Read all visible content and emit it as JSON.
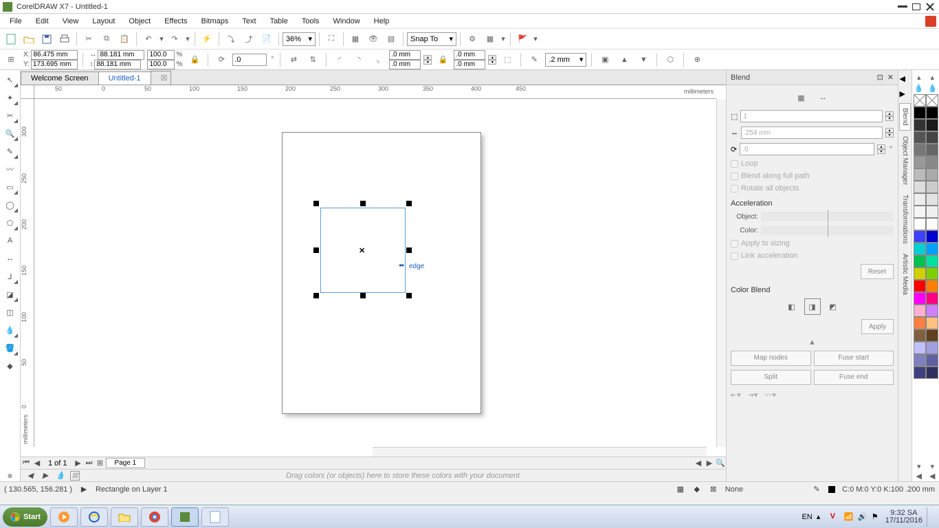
{
  "title": "CorelDRAW X7 - Untitled-1",
  "menu": [
    "File",
    "Edit",
    "View",
    "Layout",
    "Object",
    "Effects",
    "Bitmaps",
    "Text",
    "Table",
    "Tools",
    "Window",
    "Help"
  ],
  "toolbar1": {
    "zoom": "36%",
    "snapto": "Snap To"
  },
  "propbar": {
    "x": "86.475 mm",
    "y": "173.695 mm",
    "w": "88.181 mm",
    "h": "88.181 mm",
    "sx": "100.0",
    "sy": "100.0",
    "pct": "%",
    "rot": ".0",
    "corner1": ".0 mm",
    "corner2": ".0 mm",
    "corner3": ".0 mm",
    "corner4": ".0 mm",
    "outline": ".2 mm"
  },
  "doctabs": {
    "welcome": "Welcome Screen",
    "doc": "Untitled-1"
  },
  "ruler": {
    "units": "millimeters",
    "h": [
      "50",
      "0",
      "50",
      "100",
      "150",
      "200",
      "250",
      "300",
      "350",
      "400",
      "450"
    ],
    "v": [
      "300",
      "250",
      "200",
      "150",
      "100",
      "50",
      "0"
    ]
  },
  "canvas": {
    "edge": "edge"
  },
  "pagenav": {
    "of": "1 of 1",
    "tab": "Page 1"
  },
  "docpalette": "Drag colors (or objects) here to store these colors with your document",
  "docker": {
    "title": "Blend",
    "steps": "1",
    "spacing": ".254 mm",
    "angle": ".0",
    "loop": "Loop",
    "fullpath": "Blend along full path",
    "rotate": "Rotate all objects",
    "accel": "Acceleration",
    "obj": "Object:",
    "color": "Color:",
    "applysize": "Apply to sizing",
    "linkaccel": "Link acceleration",
    "reset": "Reset",
    "colorblend": "Color Blend",
    "apply": "Apply",
    "mapnodes": "Map nodes",
    "fusestart": "Fuse start",
    "split": "Split",
    "fuseend": "Fuse end"
  },
  "dockertabs": [
    "Blend",
    "Object Manager",
    "Transformations",
    "Artistic Media"
  ],
  "status": {
    "coords": "( 130.565, 156.281 )",
    "obj": "Rectangle on Layer 1",
    "fill": "None",
    "outline": "C:0 M:0 Y:0 K:100  .200 mm"
  },
  "taskbar": {
    "start": "Start",
    "lang": "EN",
    "time": "9:32 SA",
    "date": "17/11/2016"
  },
  "degree": "°"
}
